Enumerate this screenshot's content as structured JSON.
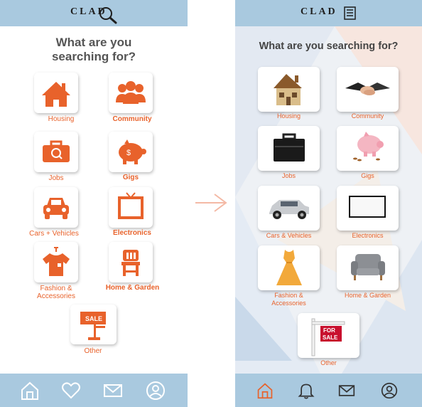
{
  "app": {
    "logo": "CLAD"
  },
  "left_screen": {
    "title_line1": "What are you",
    "title_line2": "searching for?",
    "categories": [
      {
        "label": "Housing",
        "icon": "house-icon"
      },
      {
        "label": "Community",
        "icon": "people-icon"
      },
      {
        "label": "Jobs",
        "icon": "briefcase-icon"
      },
      {
        "label": "Gigs",
        "icon": "piggy-bank-icon"
      },
      {
        "label": "Cars + Vehicles",
        "icon": "car-icon"
      },
      {
        "label": "Electronics",
        "icon": "tv-icon"
      },
      {
        "label": "Fashion &",
        "label2": "Accessories",
        "icon": "shirt-icon"
      },
      {
        "label": "Home & Garden",
        "icon": "chair-icon"
      },
      {
        "label": "Other",
        "icon": "sale-sign-icon"
      }
    ],
    "nav": [
      "home-icon",
      "heart-icon",
      "mail-icon",
      "profile-icon"
    ]
  },
  "right_screen": {
    "title": "What are you searching for?",
    "categories": [
      {
        "label": "Housing"
      },
      {
        "label": "Community"
      },
      {
        "label": "Jobs"
      },
      {
        "label": "Gigs"
      },
      {
        "label": "Cars & Vehicles"
      },
      {
        "label": "Electronics"
      },
      {
        "label": "Fashion &",
        "label2": "Accessories"
      },
      {
        "label": "Home & Garden"
      },
      {
        "label": "Other"
      }
    ],
    "nav": [
      "home-icon",
      "bell-icon",
      "mail-icon",
      "profile-icon"
    ]
  },
  "colors": {
    "accent": "#e8622b",
    "bar": "#a9c9df",
    "arrow": "#f4b9a5"
  }
}
